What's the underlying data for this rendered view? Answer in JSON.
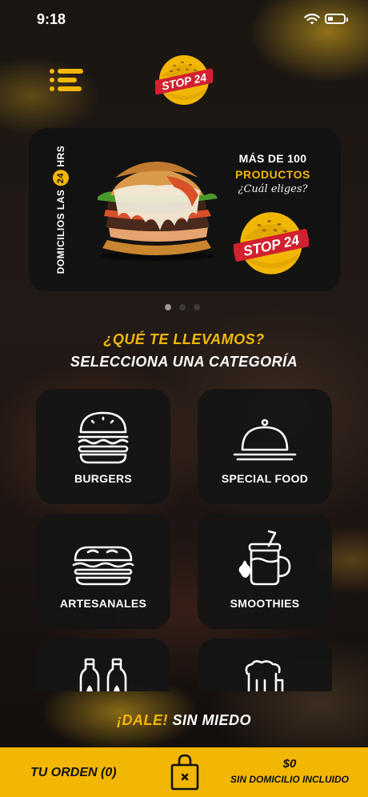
{
  "status_bar": {
    "time": "9:18"
  },
  "header": {
    "menu_icon": "menu-icon",
    "logo_text": "STOP 24"
  },
  "banner": {
    "vertical_prefix": "DOMICILIOS LAS",
    "vertical_number": "24",
    "vertical_suffix": "HRS",
    "headline_prefix": "MÁS DE",
    "headline_number": "100",
    "headline_line2": "PRODUCTOS",
    "tagline": "¿Cuál eliges?",
    "logo_text": "STOP 24",
    "pages": 3,
    "active_page": 1
  },
  "section": {
    "question": "¿QUÉ TE LLEVAMOS?",
    "subtitle": "SELECCIONA UNA CATEGORÍA"
  },
  "categories": [
    {
      "label": "BURGERS",
      "icon": "burger-icon"
    },
    {
      "label": "SPECIAL FOOD",
      "icon": "cloche-icon"
    },
    {
      "label": "ARTESANALES",
      "icon": "sandwich-icon"
    },
    {
      "label": "SMOOTHIES",
      "icon": "smoothie-icon"
    },
    {
      "label": "",
      "icon": "bottles-icon"
    },
    {
      "label": "",
      "icon": "beer-icon"
    }
  ],
  "footer_slogan": {
    "highlight": "¡DALE!",
    "rest": "SIN MIEDO"
  },
  "order_bar": {
    "label": "TU ORDEN (0)",
    "icon": "shopping-bag-icon",
    "total": "$0",
    "note": "SIN DOMICILIO INCLUIDO"
  },
  "colors": {
    "accent": "#f2b705",
    "card": "#141414",
    "logo_red": "#d2202f"
  }
}
